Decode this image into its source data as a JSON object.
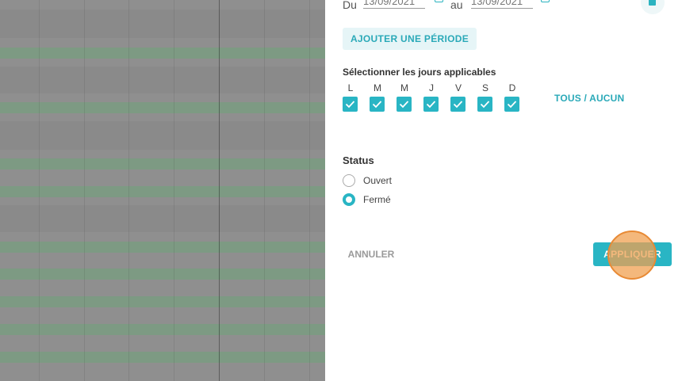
{
  "period": {
    "from_label": "Du",
    "from_value": "13/09/2021",
    "to_label": "au",
    "to_value": "13/09/2021"
  },
  "add_period_label": "AJOUTER UNE PÉRIODE",
  "days": {
    "title": "Sélectionner les jours applicables",
    "letters": [
      "L",
      "M",
      "M",
      "J",
      "V",
      "S",
      "D"
    ],
    "checked": [
      true,
      true,
      true,
      true,
      true,
      true,
      true
    ],
    "all_none_label": "TOUS / AUCUN"
  },
  "status": {
    "title": "Status",
    "options": [
      {
        "label": "Ouvert",
        "selected": false
      },
      {
        "label": "Fermé",
        "selected": true
      }
    ]
  },
  "actions": {
    "cancel_label": "ANNULER",
    "apply_label": "APPLIQUER"
  },
  "colors": {
    "accent": "#29b5c4",
    "accent_text": "#2aa9b8",
    "add_button_bg": "#e6f5f7",
    "cursor_highlight": "#f0a050"
  }
}
